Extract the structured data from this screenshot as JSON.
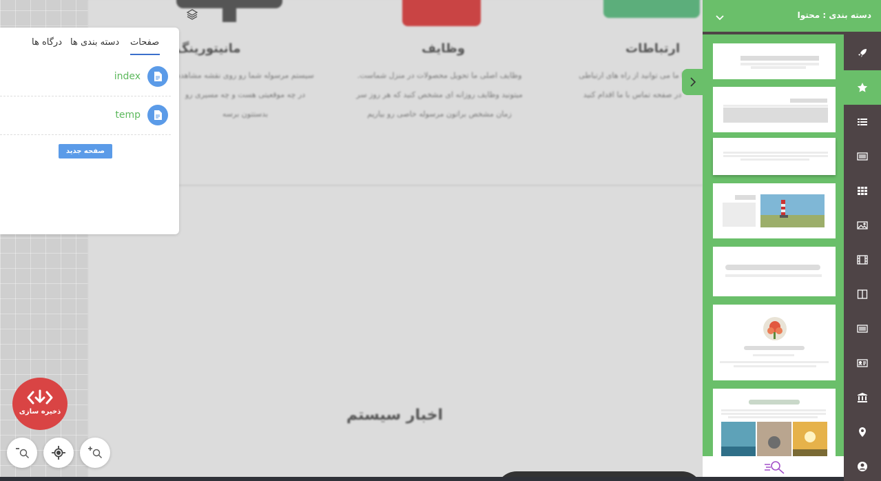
{
  "background": {
    "features": [
      {
        "title": "مانیتورینگ",
        "lines": [
          "سیستم مرسوله شما رو روی نقشه مشاهده",
          "در چه موقعیتی هست و چه مسیری رو",
          "بدستتون برسه"
        ]
      },
      {
        "title": "وظایف",
        "lines": [
          "وظایف اصلی ما تحویل محصولات در منزل شماست.",
          "میتونید وظایف روزانه ای مشخص کنید که هر روز سر",
          "زمان مشخص براتون مرسوله خاصی رو بیاریم"
        ]
      },
      {
        "title": "ارتباطات",
        "lines": [
          "با ما می توانید از راه های ارتباطی",
          "در صفحه تماس با ما اقدام کنید"
        ]
      }
    ],
    "news_title": "اخبار سیستم"
  },
  "pages_panel": {
    "tabs": [
      {
        "label": "صفحات",
        "active": true
      },
      {
        "label": "دسته بندی ها",
        "active": false
      },
      {
        "label": "درگاه ها",
        "active": false
      }
    ],
    "pages": [
      {
        "name": "index"
      },
      {
        "name": "temp"
      }
    ],
    "new_page_label": "صفحه جدید"
  },
  "controls": {
    "save_label": "ذخیره سازی",
    "zoom_out_label": "-",
    "zoom_in_label": "+"
  },
  "right_panel": {
    "header_title": "دسته بندی :  محتوا",
    "accent_color": "#6abf6a",
    "sidebar_color": "#4e4446",
    "sidebar_icons": [
      "rocket-icon",
      "star-icon",
      "list-icon",
      "news-list-icon",
      "grid-icon",
      "image-icon",
      "film-icon",
      "columns-icon",
      "article-icon",
      "id-card-icon",
      "bank-icon",
      "map-pin-icon",
      "user-circle-icon"
    ],
    "active_icon": "star-icon"
  }
}
